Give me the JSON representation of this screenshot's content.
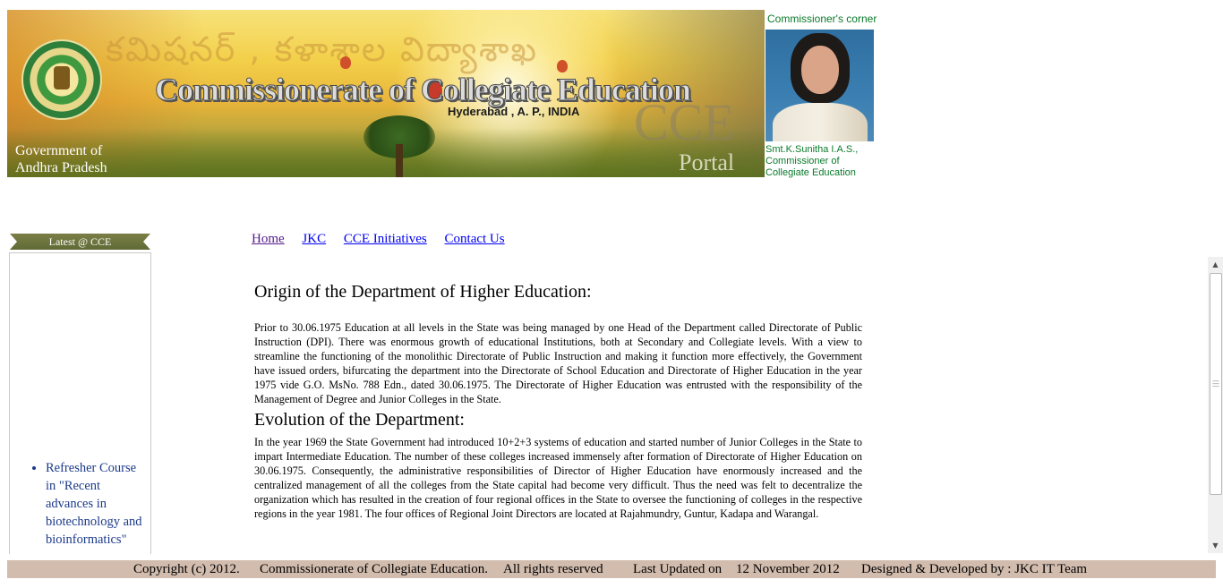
{
  "banner": {
    "telugu_text": "కమిషనర్ , కళాశాల విద్యాశాఖ",
    "title": "Commissionerate of Collegiate Education",
    "location": "Hyderabad , A. P., INDIA",
    "gov_line1": "Government of",
    "gov_line2": "Andhra Pradesh",
    "watermark": "CCE",
    "portal": "Portal"
  },
  "commissioner": {
    "heading": "Commissioner's corner",
    "name": "Smt.K.Sunitha I.A.S.,",
    "role_line1": "Commissioner of",
    "role_line2": "Collegiate Education"
  },
  "sidebar": {
    "heading": "Latest @ CCE",
    "items": [
      {
        "lines": [
          "Refresher Course",
          "in \"Recent",
          "advances in",
          "biotechnology and",
          "bioinformatics\""
        ]
      }
    ]
  },
  "nav": {
    "links": [
      "Home",
      "JKC",
      "CCE Initiatives",
      "Contact Us"
    ]
  },
  "content": {
    "origin_heading": "Origin of the Department of Higher Education:",
    "origin_text": "Prior to 30.06.1975 Education at all levels in the State was being managed by one Head of the Department called Directorate of Public Instruction (DPI). There was enormous growth of educational Institutions, both at Secondary and Collegiate levels. With a view to streamline the functioning of the monolithic Directorate of Public Instruction and making it function more effectively, the Government have issued orders, bifurcating the department into the Directorate of School Education and Directorate of Higher Education in the year 1975 vide G.O. MsNo. 788 Edn., dated 30.06.1975. The Directorate of Higher Education was entrusted with the responsibility of the Management of Degree and Junior Colleges in the State.",
    "evolution_heading": "Evolution of the Department:",
    "evolution_text": "In the year 1969 the State Government had introduced 10+2+3 systems of education and started number of Junior Colleges in the State to impart Intermediate Education. The number of these colleges increased immensely after formation of Directorate of Higher Education on 30.06.1975. Consequently, the administrative responsibilities of Director of Higher Education have enormously increased and the centralized management of all the colleges from the State capital had become very difficult. Thus the need was felt to decentralize the organization which has resulted in the creation of four regional offices in the State to oversee the functioning of colleges in the respective regions in the year 1981. The four offices of Regional Joint Directors are located at Rajahmundry, Guntur, Kadapa and Warangal."
  },
  "footer": {
    "copyright": "Copyright (c) 2012.",
    "org": "Commissionerate of Collegiate Education.",
    "rights": "All rights reserved",
    "updated_label": "Last Updated on",
    "updated_date": "12 November 2012",
    "designed": "Designed & Developed by : JKC IT Team"
  },
  "colors": {
    "link": "#0000ee",
    "visited_link": "#551a8b",
    "commissioner_green": "#0a7a2a",
    "footer_bg": "#d2bcae",
    "sidebar_item": "#1c3a8a"
  },
  "icons": [
    "scroll-up-arrow-icon",
    "scroll-down-arrow-icon",
    "scroll-grip-icon"
  ]
}
